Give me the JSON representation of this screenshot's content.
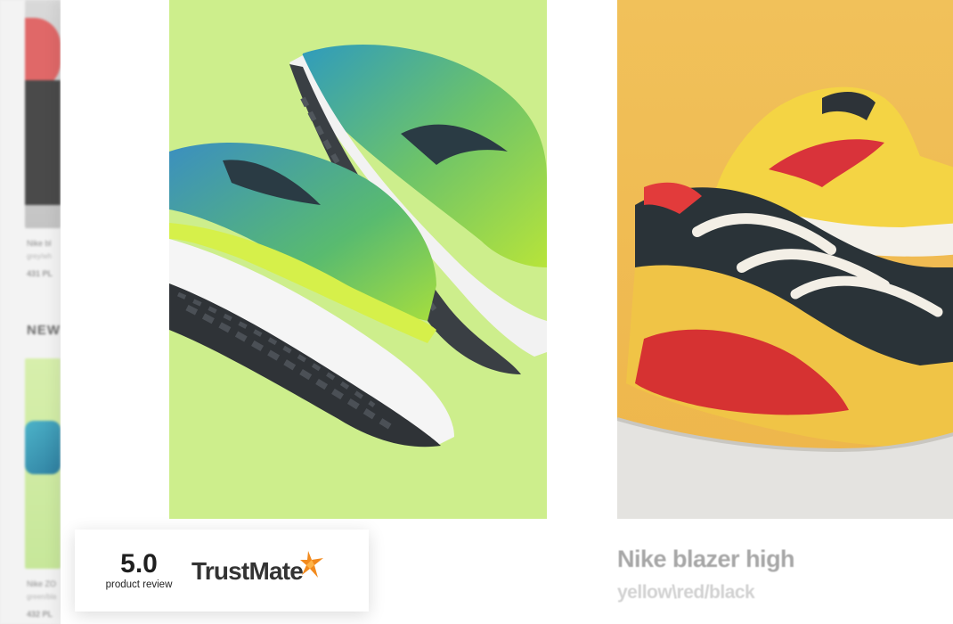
{
  "background_page": {
    "top_product": {
      "name": "Nike bl",
      "colors": "grey/wh",
      "price": "431 PL"
    },
    "section_heading": "NEW",
    "bottom_product": {
      "name": "Nike ZO",
      "colors": "green/bla",
      "price": "432 PL"
    }
  },
  "products": [
    {
      "name": "",
      "colors": "",
      "image": "green-blue-running-shoes-photo"
    },
    {
      "name": "Nike blazer high",
      "colors": "yellow\\red/black",
      "image": "yellow-red-black-blazer-photo"
    }
  ],
  "trust_widget": {
    "rating": "5.0",
    "caption": "product review",
    "brand": "TrustMate",
    "brand_icon": "trustmate-star-icon",
    "colors": {
      "accent": "#f28a1e",
      "text": "#333333"
    }
  }
}
